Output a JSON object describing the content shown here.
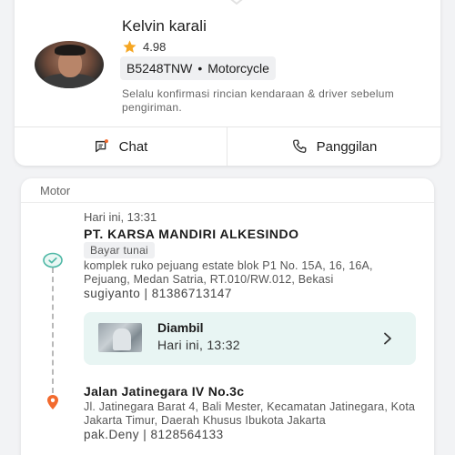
{
  "driver": {
    "name": "Kelvin karali",
    "rating": "4.98",
    "plate": "B5248TNW",
    "separator": "•",
    "vehicle": "Motorcycle",
    "note": "Selalu konfirmasi rincian kendaraan & driver sebelum pengiriman."
  },
  "actions": {
    "chat_label": "Chat",
    "call_label": "Panggilan"
  },
  "delivery": {
    "vehicle_type": "Motor",
    "pickup": {
      "time": "Hari ini, 13:31",
      "name": "PT. KARSA MANDIRI ALKESINDO",
      "payment": "Bayar tunai",
      "address": "komplek ruko pejuang estate blok P1 No. 15A, 16, 16A, Pejuang, Medan Satria, RT.010/RW.012, Bekasi",
      "contact": "sugiyanto | 81386713147"
    },
    "status": {
      "title": "Diambil",
      "time": "Hari ini, 13:32"
    },
    "dropoff": {
      "name": "Jalan Jatinegara IV No.3c",
      "address": "Jl. Jatinegara Barat 4, Bali Mester, Kecamatan Jatinegara, Kota Jakarta Timur, Daerah Khusus Ibukota Jakarta",
      "contact": "pak.Deny | 8128564133"
    }
  },
  "colors": {
    "accent_teal": "#4fb8a6",
    "star": "#f5a623",
    "pin": "#f26a2e",
    "status_bg": "#e8f5f3",
    "chat_dot": "#f26a2e"
  },
  "icons": {
    "rating": "star-icon",
    "chat": "chat-bubble-icon",
    "call": "phone-icon",
    "pickup": "pickup-check-icon",
    "dropoff": "location-pin-icon",
    "status": "chevron-right-icon"
  }
}
